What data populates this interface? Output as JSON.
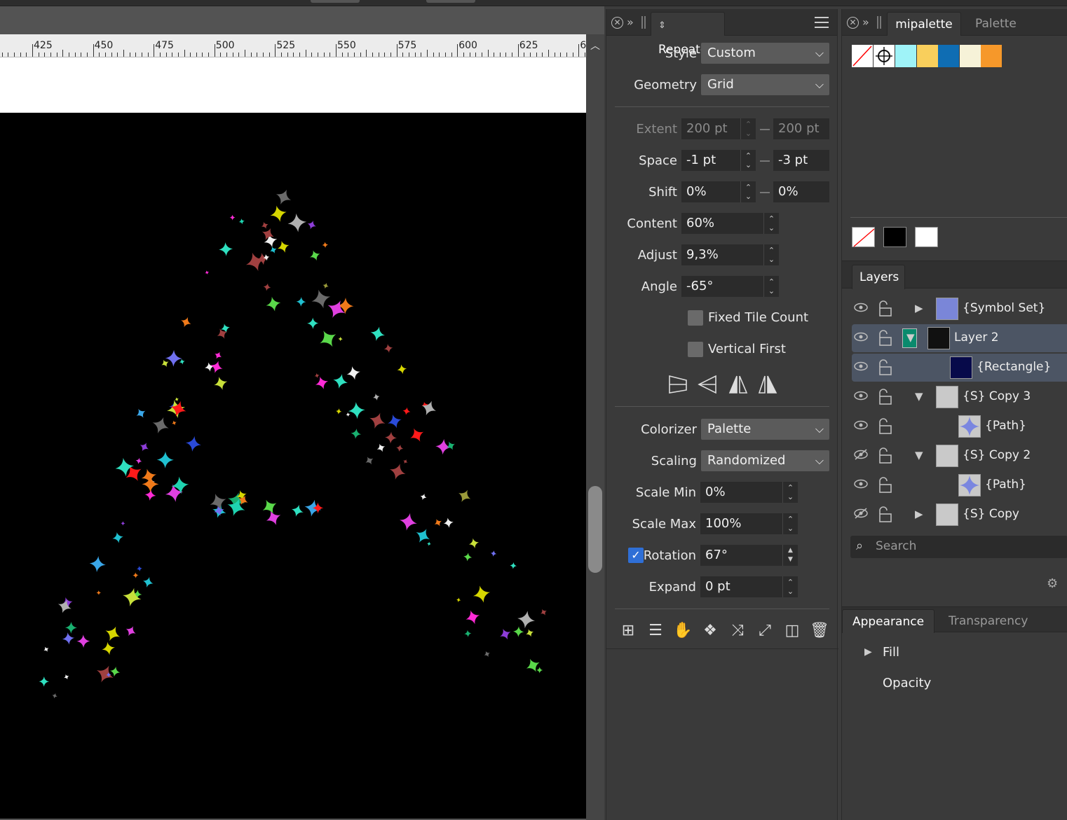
{
  "ruler": {
    "labels": [
      "425",
      "450",
      "475",
      "500",
      "525",
      "550",
      "575",
      "600",
      "625",
      "6"
    ]
  },
  "repeater_panel": {
    "tab_title": "Repeater",
    "style": {
      "label": "Style",
      "value": "Custom"
    },
    "geometry": {
      "label": "Geometry",
      "value": "Grid"
    },
    "extent": {
      "label": "Extent",
      "value1": "200 pt",
      "value2": "200 pt"
    },
    "space": {
      "label": "Space",
      "value1": "-1 pt",
      "value2": "-3 pt"
    },
    "shift": {
      "label": "Shift",
      "value1": "0%",
      "value2": "0%"
    },
    "content": {
      "label": "Content",
      "value": "60%"
    },
    "adjust": {
      "label": "Adjust",
      "value": "9,3%"
    },
    "angle": {
      "label": "Angle",
      "value": "-65°"
    },
    "fixed_tile_count": {
      "label": "Fixed Tile Count",
      "checked": false
    },
    "vertical_first": {
      "label": "Vertical First",
      "checked": false
    },
    "colorizer": {
      "label": "Colorizer",
      "value": "Palette"
    },
    "scaling": {
      "label": "Scaling",
      "value": "Randomized"
    },
    "scale_min": {
      "label": "Scale Min",
      "value": "0%"
    },
    "scale_max": {
      "label": "Scale Max",
      "value": "100%"
    },
    "rotation": {
      "label": "Rotation",
      "value": "67°",
      "checked": true
    },
    "expand": {
      "label": "Expand",
      "value": "0 pt"
    }
  },
  "palette_panel": {
    "tabs": [
      "mipalette",
      "Palette"
    ],
    "colors": [
      "#9ff3f8",
      "#f9cf5c",
      "#0f6db3",
      "#f6f2d8",
      "#f6982a"
    ],
    "base_colors": [
      "#000000",
      "#ffffff"
    ]
  },
  "layers_panel": {
    "tab": "Layers",
    "layers": [
      {
        "name": "{Symbol Set}",
        "visible": true,
        "expander": "▶"
      },
      {
        "name": "Layer 2",
        "visible": true,
        "expander": "▼"
      },
      {
        "name": "{Rectangle}",
        "visible": true,
        "expander": ""
      },
      {
        "name": "{S} Copy 3",
        "visible": true,
        "expander": "▼"
      },
      {
        "name": "{Path}",
        "visible": true,
        "expander": ""
      },
      {
        "name": "{S} Copy 2",
        "visible": false,
        "expander": "▼"
      },
      {
        "name": "{Path}",
        "visible": true,
        "expander": ""
      },
      {
        "name": "{S} Copy",
        "visible": false,
        "expander": "▶"
      }
    ],
    "search_placeholder": "Search"
  },
  "appearance_panel": {
    "tabs": [
      "Appearance",
      "Transparency"
    ],
    "fill_label": "Fill",
    "opacity_label": "Opacity"
  }
}
